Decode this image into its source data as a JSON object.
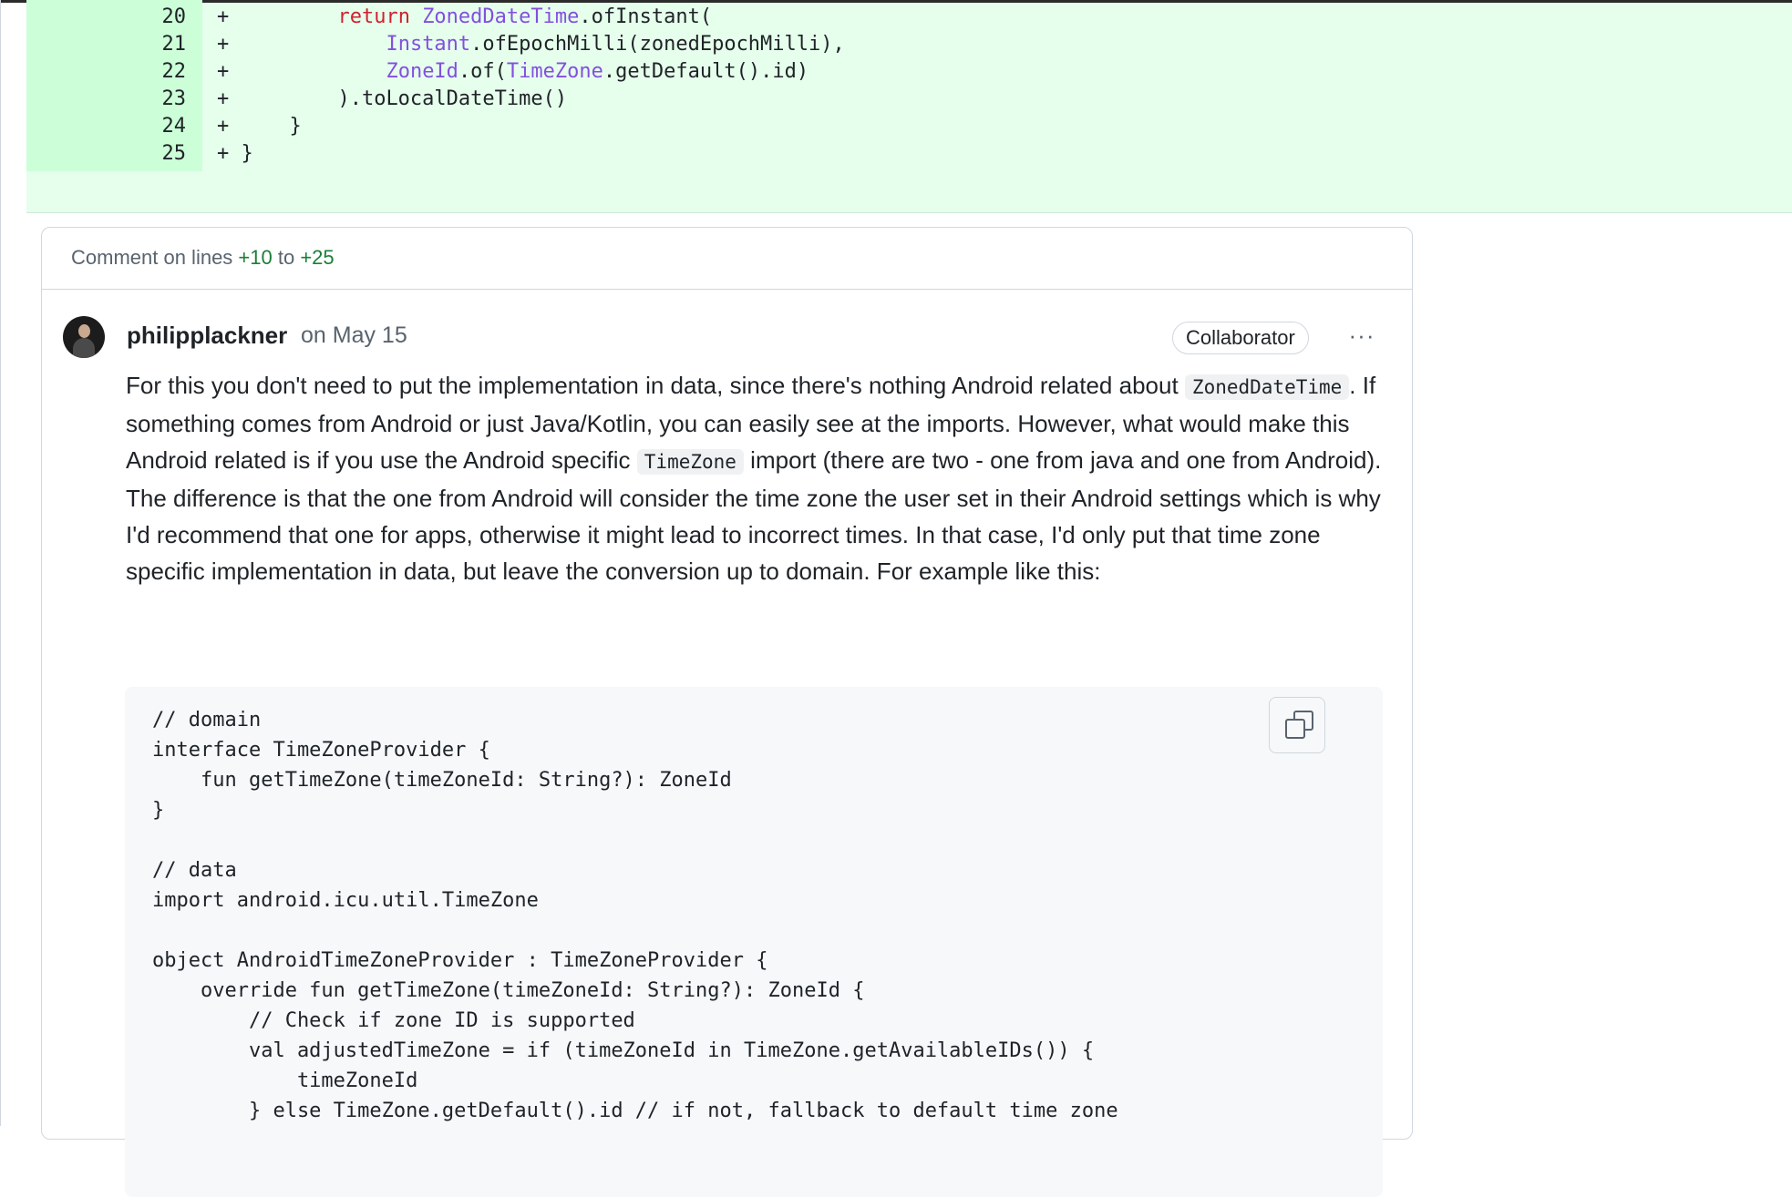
{
  "diff_lines": [
    {
      "num": "20",
      "sign": "+",
      "parts": [
        [
          "",
          "        "
        ],
        [
          "kw",
          "return "
        ],
        [
          "ty",
          "ZonedDateTime"
        ],
        [
          "",
          ".ofInstant("
        ]
      ]
    },
    {
      "num": "21",
      "sign": "+",
      "parts": [
        [
          "",
          "            "
        ],
        [
          "ty",
          "Instant"
        ],
        [
          "",
          ".ofEpochMilli(zonedEpochMilli),"
        ]
      ]
    },
    {
      "num": "22",
      "sign": "+",
      "parts": [
        [
          "",
          "            "
        ],
        [
          "ty",
          "ZoneId"
        ],
        [
          "",
          ".of("
        ],
        [
          "ty",
          "TimeZone"
        ],
        [
          "",
          ".getDefault().id)"
        ]
      ]
    },
    {
      "num": "23",
      "sign": "+",
      "parts": [
        [
          "",
          "        ).toLocalDateTime()"
        ]
      ]
    },
    {
      "num": "24",
      "sign": "+",
      "parts": [
        [
          "",
          "    }"
        ]
      ]
    },
    {
      "num": "25",
      "sign": "+",
      "parts": [
        [
          "",
          "}"
        ]
      ]
    }
  ],
  "thread": {
    "title_prefix": "Comment on lines ",
    "range_start": "+10",
    "title_mid": " to ",
    "range_end": "+25"
  },
  "comment": {
    "author": "philipplackner",
    "date": "on May 15",
    "badge": "Collaborator",
    "menu": "···",
    "p1_a": "For this you don't need to put the implementation in data, since there's nothing Android related about",
    "p1_code1": "ZonedDateTime",
    "p1_b": ". If something comes from Android or just Java/Kotlin, you can easily see at the imports. However, what would make this Android related is if you use the Android specific",
    "p1_code2": "TimeZone",
    "p1_c": "import (there are two - one from java and one from Android).",
    "p2": "The difference is that the one from Android will consider the time zone the user set in their Android settings which is why I'd recommend that one for apps, otherwise it might lead to incorrect times. In that case, I'd only put that time zone specific implementation in data, but leave the conversion up to domain. For example like this:"
  },
  "code_block": [
    "// domain",
    "interface TimeZoneProvider {",
    "    fun getTimeZone(timeZoneId: String?): ZoneId",
    "}",
    "",
    "// data",
    "import android.icu.util.TimeZone",
    "",
    "object AndroidTimeZoneProvider : TimeZoneProvider {",
    "    override fun getTimeZone(timeZoneId: String?): ZoneId {",
    "        // Check if zone ID is supported",
    "        val adjustedTimeZone = if (timeZoneId in TimeZone.getAvailableIDs()) {",
    "            timeZoneId",
    "        } else TimeZone.getDefault().id // if not, fallback to default time zone"
  ],
  "icons": {
    "copy": "copy-icon",
    "menu": "kebab-horizontal-icon",
    "avatar": "avatar"
  },
  "colors": {
    "added_bg": "#e6ffec",
    "added_gutter": "#ccffd8",
    "keyword": "#cf222e",
    "type": "#8250df",
    "range": "#1a7f37"
  }
}
